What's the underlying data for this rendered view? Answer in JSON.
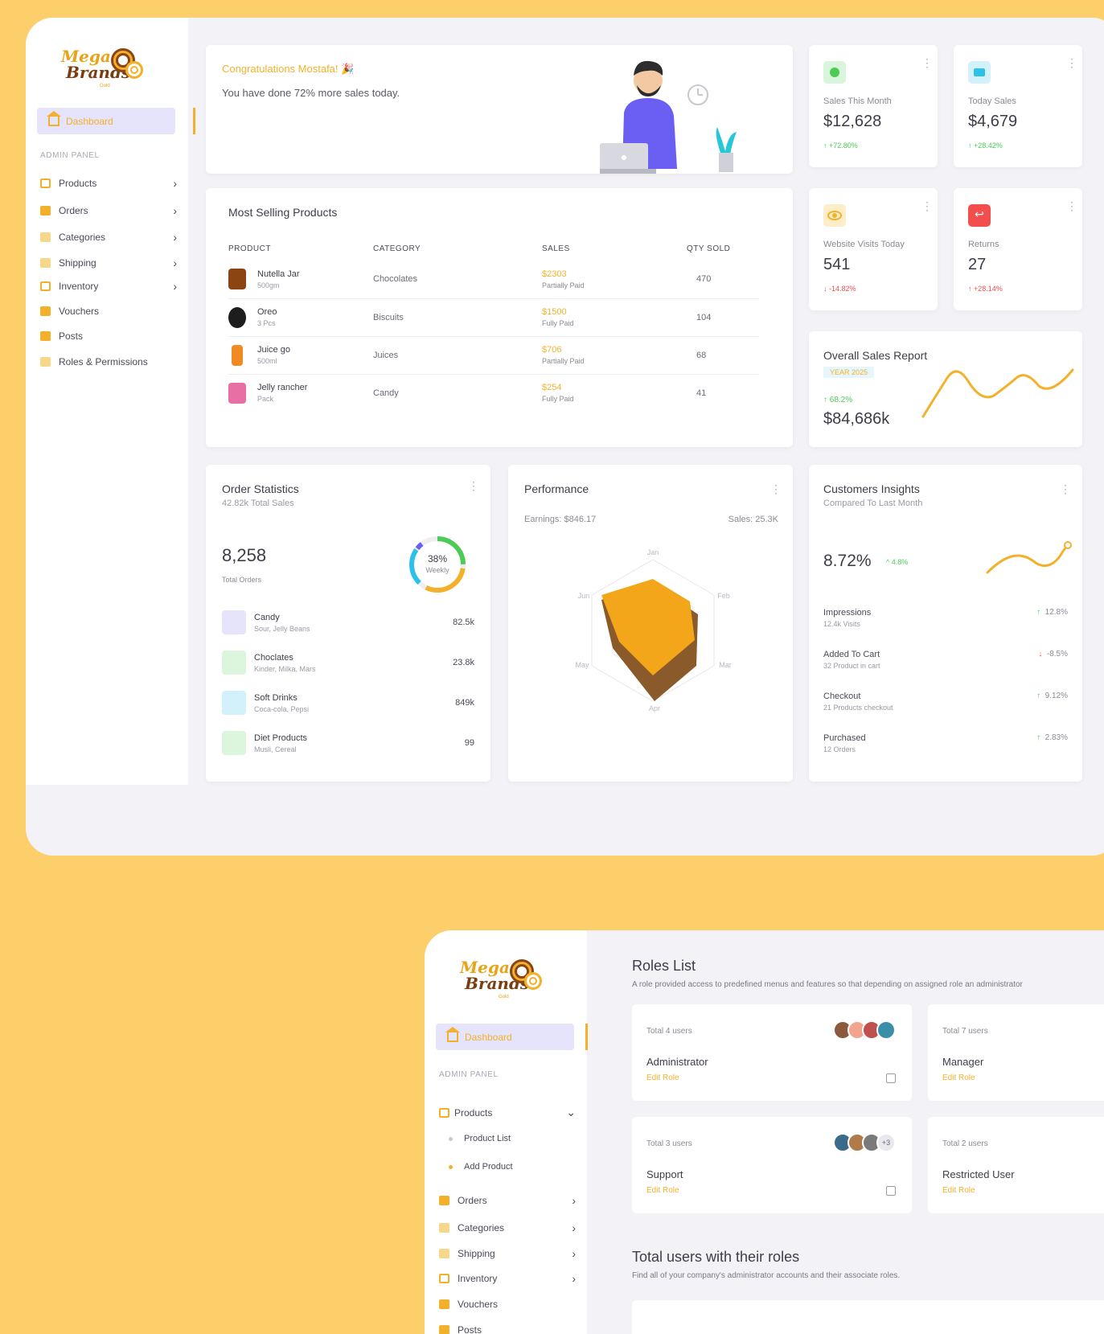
{
  "brand": {
    "mega": "Mega",
    "brands": "Brands",
    "gold": "Gold"
  },
  "sidebar": {
    "active": "Dashboard",
    "section_label": "ADMIN PANEL",
    "items": [
      {
        "label": "Products",
        "icon": "cart-icon"
      },
      {
        "label": "Orders",
        "icon": "orders-icon"
      },
      {
        "label": "Categories",
        "icon": "categories-icon"
      },
      {
        "label": "Shipping",
        "icon": "truck-icon"
      },
      {
        "label": "Inventory",
        "icon": "warehouse-icon"
      },
      {
        "label": "Vouchers",
        "icon": "voucher-icon"
      },
      {
        "label": "Posts",
        "icon": "posts-icon"
      },
      {
        "label": "Roles & Permissions",
        "icon": "roles-icon"
      }
    ]
  },
  "congrats": {
    "title": "Congratulations Mostafa! 🎉",
    "text": "You have done 72% more sales today."
  },
  "stats": [
    {
      "label": "Sales This Month",
      "value": "$12,628",
      "change": "+72.80%",
      "dir": "up",
      "color": "#d9f5dc",
      "fg": "#4ccc55"
    },
    {
      "label": "Today Sales",
      "value": "$4,679",
      "change": "+28.42%",
      "dir": "up",
      "color": "#d3f1fb",
      "fg": "#2cc1e8"
    },
    {
      "label": "Website Visits Today",
      "value": "541",
      "change": "-14.82%",
      "dir": "down",
      "color": "#fdeec9",
      "fg": "#F3B12B"
    },
    {
      "label": "Returns",
      "value": "27",
      "change": "+28.14%",
      "dir": "down",
      "color": "#fde0e0",
      "fg": "#f24e4e"
    }
  ],
  "most_selling": {
    "title": "Most Selling Products",
    "headers": [
      "PRODUCT",
      "CATEGORY",
      "SALES",
      "QTY SOLD"
    ],
    "rows": [
      {
        "name": "Nutella Jar",
        "size": "500gm",
        "category": "Chocolates",
        "amount": "$2303",
        "status": "Partially Paid",
        "qty": "470",
        "img": "#8b4513"
      },
      {
        "name": "Oreo",
        "size": "3 Pcs",
        "category": "Biscuits",
        "amount": "$1500",
        "status": "Fully Paid",
        "qty": "104",
        "img": "#1d1d1d"
      },
      {
        "name": "Juice go",
        "size": "500ml",
        "category": "Juices",
        "amount": "$706",
        "status": "Partially Paid",
        "qty": "68",
        "img": "#f08a24"
      },
      {
        "name": "Jelly rancher",
        "size": "Pack",
        "category": "Candy",
        "amount": "$254",
        "status": "Fully Paid",
        "qty": "41",
        "img": "#e86fa4"
      }
    ]
  },
  "overall": {
    "title": "Overall Sales Report",
    "badge": "YEAR 2025",
    "change": "68.2%",
    "value": "$84,686k"
  },
  "order_stats": {
    "title": "Order Statistics",
    "sub": "42.82k Total Sales",
    "total": "8,258",
    "total_label": "Total Orders",
    "ring_pct": "38%",
    "ring_label": "Weekly",
    "rows": [
      {
        "name": "Candy",
        "desc": "Sour, Jelly Beans",
        "value": "82.5k",
        "color": "#e6e4fb"
      },
      {
        "name": "Choclates",
        "desc": "Kinder, Milka, Mars",
        "value": "23.8k",
        "color": "#dcf5dd"
      },
      {
        "name": "Soft Drinks",
        "desc": "Coca-cola, Pepsi",
        "value": "849k",
        "color": "#d3f1fb"
      },
      {
        "name": "Diet Products",
        "desc": "Musli, Cereal",
        "value": "99",
        "color": "#dcf5dd"
      }
    ]
  },
  "performance": {
    "title": "Performance",
    "earnings": "Earnings: $846.17",
    "sales": "Sales: 25.3K",
    "axes": [
      "Jan",
      "Feb",
      "Mar",
      "Apr",
      "May",
      "Jun"
    ]
  },
  "insights": {
    "title": "Customers Insights",
    "sub": "Compared To Last Month",
    "value": "8.72%",
    "change": "4.8%",
    "rows": [
      {
        "name": "Impressions",
        "desc": "12.4k Visits",
        "value": "12.8%",
        "dir": "up"
      },
      {
        "name": "Added To Cart",
        "desc": "32 Product in cart",
        "value": "-8.5%",
        "dir": "down"
      },
      {
        "name": "Checkout",
        "desc": "21 Products checkout",
        "value": "9.12%",
        "dir": "up"
      },
      {
        "name": "Purchased",
        "desc": "12 Orders",
        "value": "2.83%",
        "dir": "up"
      }
    ]
  },
  "roles_page": {
    "sidebar": {
      "active": "Dashboard",
      "section_label": "ADMIN PANEL",
      "products": "Products",
      "product_list": "Product List",
      "add_product": "Add Product",
      "items": [
        "Orders",
        "Categories",
        "Shipping",
        "Inventory",
        "Vouchers",
        "Posts"
      ]
    },
    "title": "Roles List",
    "sub": "A role provided access to predefined menus and features so that depending on assigned role an administrator",
    "roles": [
      {
        "users": "Total 4 users",
        "role": "Administrator",
        "edit": "Edit Role",
        "more": ""
      },
      {
        "users": "Total 7 users",
        "role": "Manager",
        "edit": "Edit Role",
        "more": ""
      },
      {
        "users": "Total 3 users",
        "role": "Support",
        "edit": "Edit Role",
        "more": "+3"
      },
      {
        "users": "Total 2 users",
        "role": "Restricted User",
        "edit": "Edit Role",
        "more": ""
      }
    ],
    "users_title": "Total users with their roles",
    "users_sub": "Find all of your company's administrator accounts and their associate roles."
  }
}
